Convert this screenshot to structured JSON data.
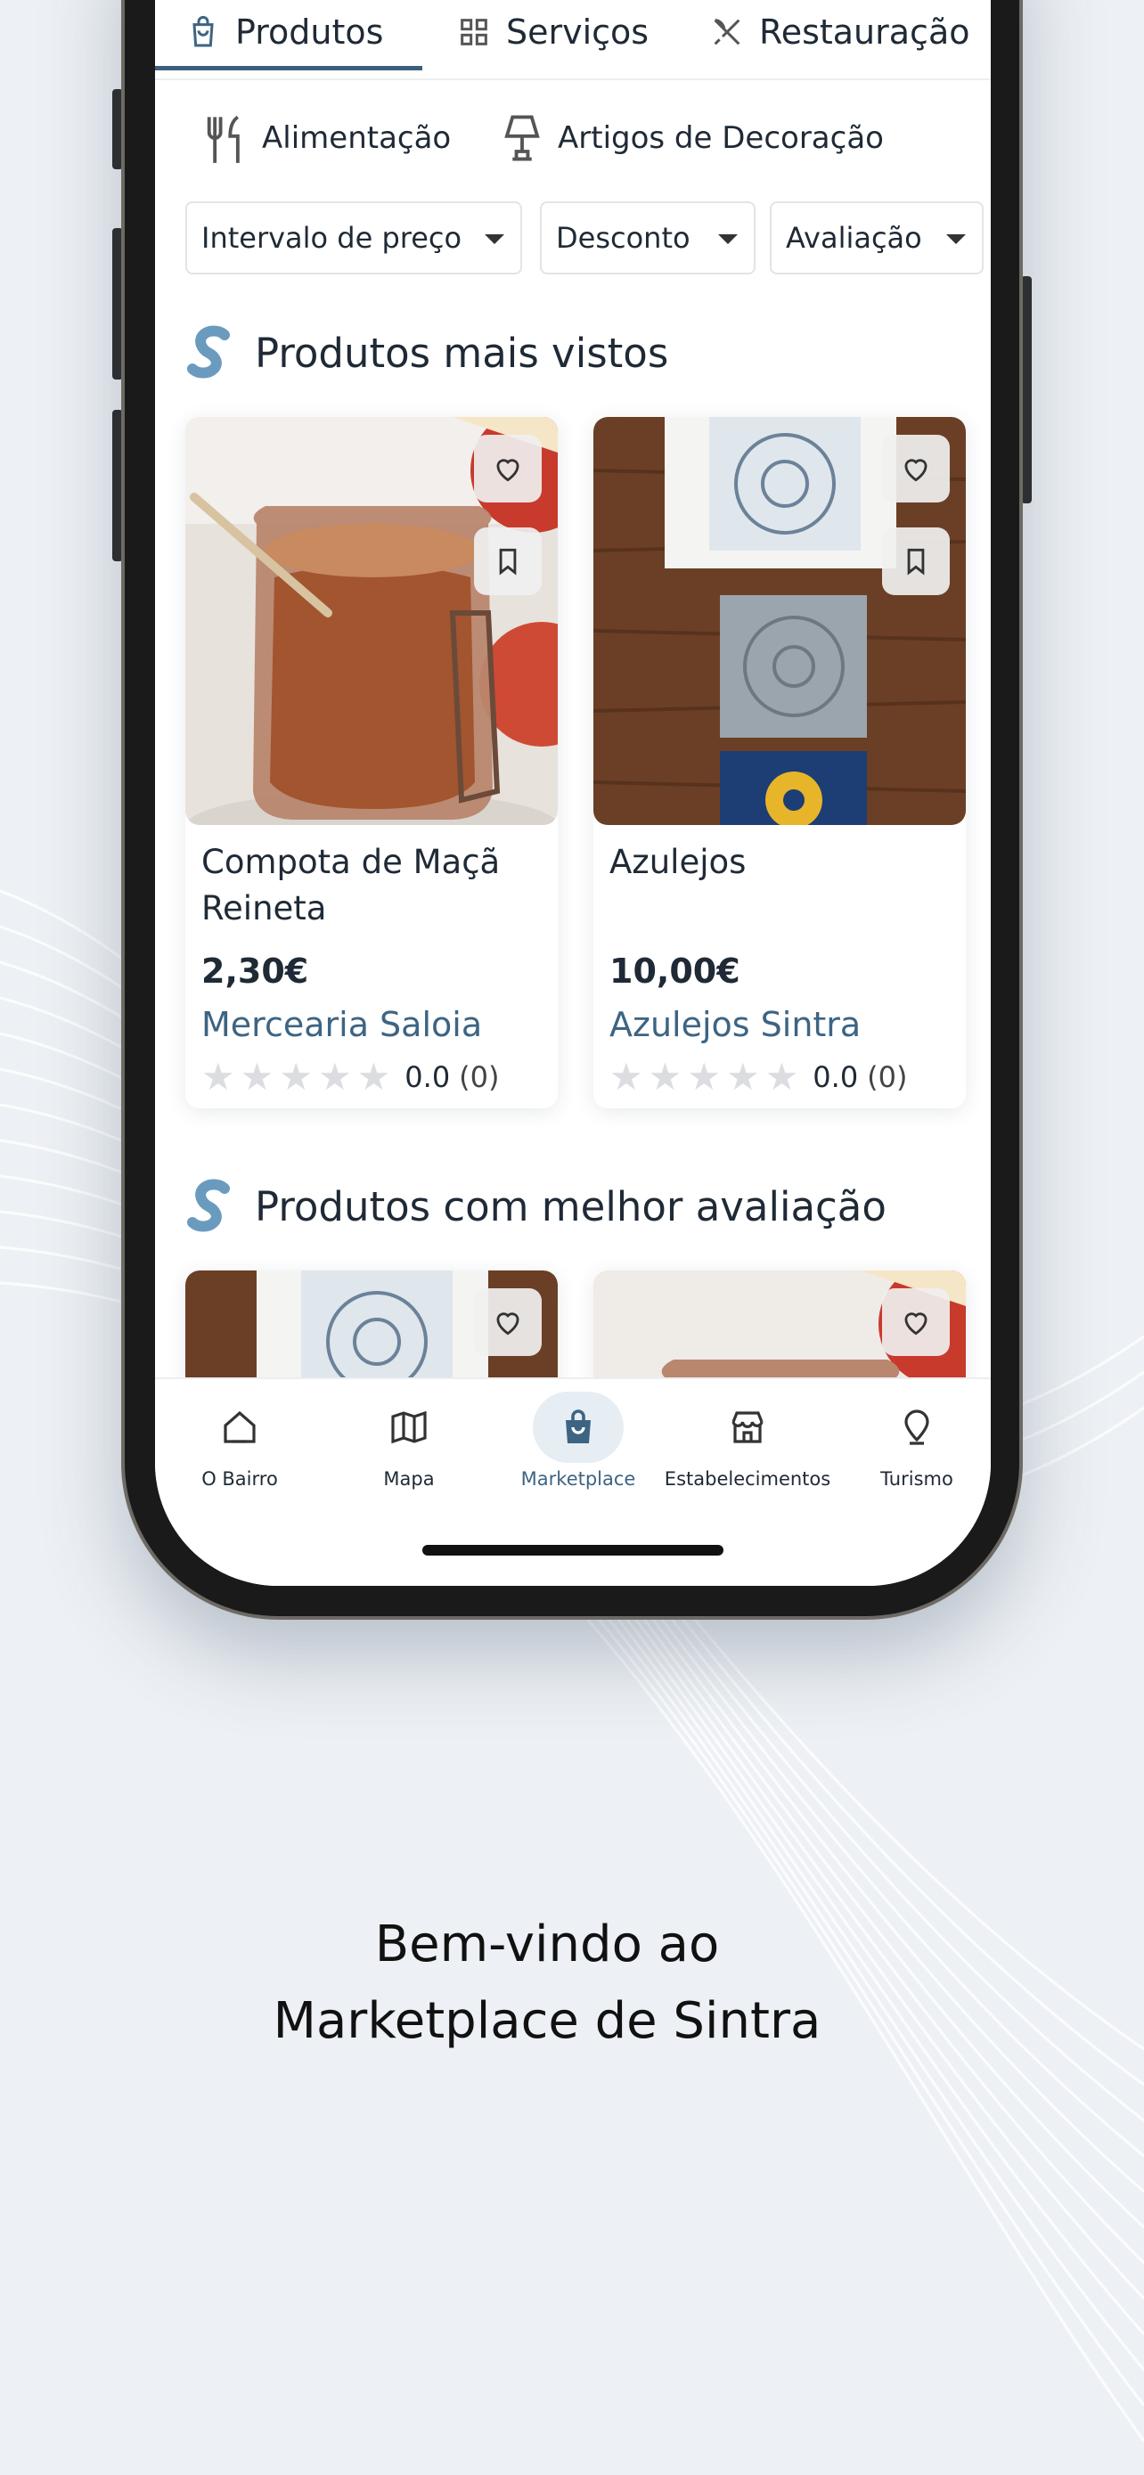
{
  "tabs": [
    {
      "label": "Produtos",
      "icon": "shopping-bag-icon",
      "active": true
    },
    {
      "label": "Serviços",
      "icon": "grid-icon",
      "active": false
    },
    {
      "label": "Restauração",
      "icon": "utensils-crossed-icon",
      "active": false
    }
  ],
  "categories": [
    {
      "label": "Alimentação",
      "icon": "fork-knife-icon"
    },
    {
      "label": "Artigos de Decoração",
      "icon": "lamp-icon"
    }
  ],
  "filters": [
    {
      "label": "Intervalo de preço"
    },
    {
      "label": "Desconto"
    },
    {
      "label": "Avaliação"
    }
  ],
  "sections": {
    "most_viewed": {
      "title": "Produtos mais vistos",
      "products": [
        {
          "name": "Compota de Maçã Reineta",
          "price": "2,30€",
          "store": "Mercearia Saloia",
          "rating": "0.0",
          "reviews": "(0)",
          "stars": 0,
          "image": "apple-jam-jar"
        },
        {
          "name": "Azulejos",
          "price": "10,00€",
          "store": "Azulejos Sintra",
          "rating": "0.0",
          "reviews": "(0)",
          "stars": 0,
          "image": "decorative-tiles"
        }
      ]
    },
    "best_rated": {
      "title": "Produtos com melhor avaliação"
    }
  },
  "bottom_nav": [
    {
      "label": "O Bairro",
      "icon": "home-icon",
      "active": false
    },
    {
      "label": "Mapa",
      "icon": "map-icon",
      "active": false
    },
    {
      "label": "Marketplace",
      "icon": "shopping-bag-icon",
      "active": true
    },
    {
      "label": "Estabelecimentos",
      "icon": "store-icon",
      "active": false
    },
    {
      "label": "Turismo",
      "icon": "map-pin-icon",
      "active": false
    }
  ],
  "welcome": {
    "line1": "Bem-vindo ao",
    "line2": "Marketplace de Sintra"
  },
  "colors": {
    "accent": "#3d6483",
    "background": "#edf1f5",
    "text": "#1f2a36",
    "star_empty": "#dcdde0"
  }
}
